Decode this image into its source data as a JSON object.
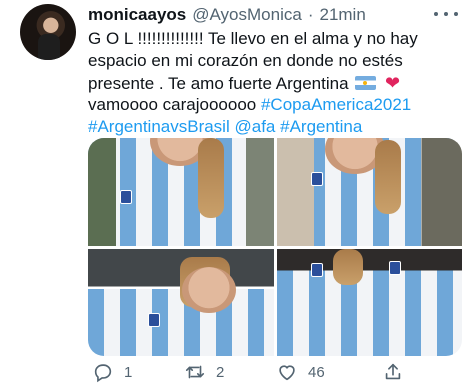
{
  "tweet": {
    "display_name": "monicaayos",
    "handle": "@AyosMonica",
    "separator": "·",
    "time": "21min",
    "text": {
      "line1": "G O L !!!!!!!!!!!!!! Te llevo en el alma y no hay",
      "line2": "espacio en mi corazón en donde no estés",
      "line3_text": "presente . Te amo fuerte Argentina",
      "line4_text": "vamoooo carajoooooo",
      "line4_hashtag": "#CopaAmerica2021",
      "line5_hashtag1": "#ArgentinavsBrasil",
      "line5_mention": "@afa",
      "line5_hashtag2": "#Argentina"
    },
    "actions": {
      "reply_count": "1",
      "retweet_count": "2",
      "like_count": "46"
    }
  },
  "colors": {
    "link": "#1d9bf0",
    "secondary_text": "#536471",
    "heart": "#e0245e"
  },
  "icons": [
    "more-horizontal-icon",
    "argentina-flag-icon",
    "red-heart-icon",
    "reply-icon",
    "retweet-icon",
    "like-icon",
    "share-icon"
  ]
}
